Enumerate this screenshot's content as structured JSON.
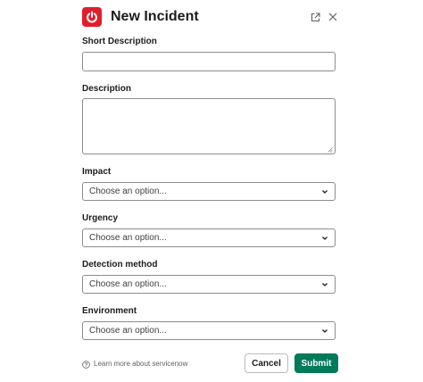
{
  "header": {
    "title": "New Incident",
    "app_icon": "servicenow-power-icon",
    "external_icon": "external-link-icon",
    "close_icon": "close-icon",
    "brand_color": "#e01e2d"
  },
  "form": {
    "short_description": {
      "label": "Short Description",
      "value": ""
    },
    "description": {
      "label": "Description",
      "value": ""
    },
    "impact": {
      "label": "Impact",
      "placeholder": "Choose an option..."
    },
    "urgency": {
      "label": "Urgency",
      "placeholder": "Choose an option..."
    },
    "detection_method": {
      "label": "Detection method",
      "placeholder": "Choose an option..."
    },
    "environment": {
      "label": "Environment",
      "placeholder": "Choose an option..."
    }
  },
  "footer": {
    "help_text": "Learn more about servicenow",
    "help_icon": "help-circle-icon",
    "cancel_label": "Cancel",
    "submit_label": "Submit",
    "submit_color": "#007a5a"
  }
}
